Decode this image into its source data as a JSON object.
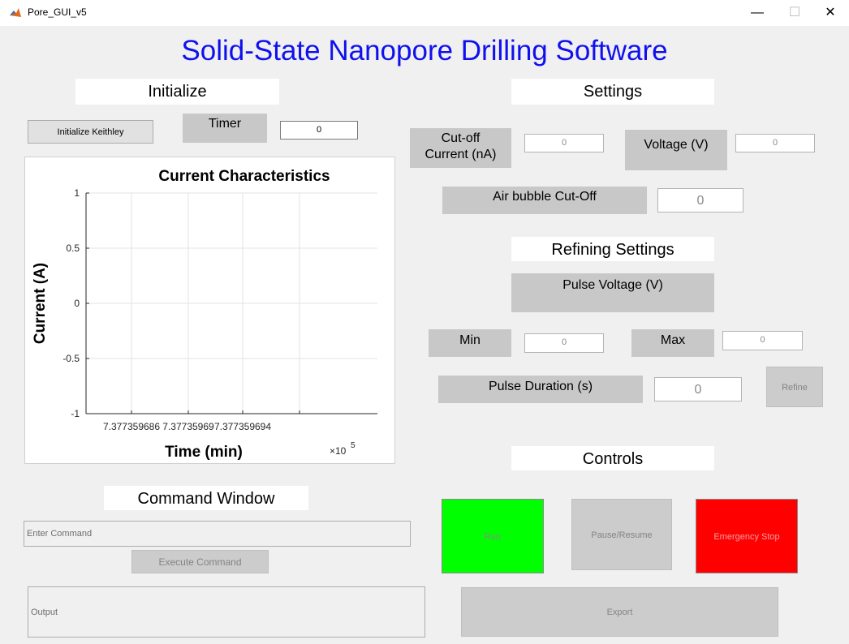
{
  "window": {
    "title": "Pore_GUI_v5",
    "minimize": "—",
    "maximize": "☐",
    "close": "✕"
  },
  "app_title": "Solid-State Nanopore Drilling Software",
  "initialize": {
    "heading": "Initialize",
    "init_button": "Initialize Keithley",
    "timer_label": "Timer",
    "timer_value": "0"
  },
  "settings": {
    "heading": "Settings",
    "cutoff_label_line1": "Cut-off",
    "cutoff_label_line2": "Current (nA)",
    "cutoff_value": "0",
    "voltage_label": "Voltage (V)",
    "voltage_value": "0",
    "airbubble_label": "Air bubble Cut-Off",
    "airbubble_value": "0"
  },
  "refining": {
    "heading": "Refining Settings",
    "pulse_voltage_label": "Pulse Voltage (V)",
    "min_label": "Min",
    "min_value": "0",
    "max_label": "Max",
    "max_value": "0",
    "pulse_duration_label": "Pulse Duration (s)",
    "pulse_duration_value": "0",
    "refine_button": "Refine"
  },
  "controls": {
    "heading": "Controls",
    "run_button": "Run",
    "pause_button": "Pause/Resume",
    "estop_button": "Emergency Stop",
    "export_button": "Export",
    "run_color": "#00ff00",
    "estop_color": "#ff0000"
  },
  "command": {
    "heading": "Command Window",
    "input_value": "Enter Command",
    "execute_button": "Execute Command",
    "output_text": "Output"
  },
  "chart_data": {
    "type": "line",
    "title": "Current Characteristics",
    "xlabel": "Time (min)",
    "ylabel": "Current (A)",
    "x_ticks": [
      "7.377359686",
      "7.37735969",
      "7.377359694"
    ],
    "x_exponent_base": "×10",
    "x_exponent_power": "5",
    "y_ticks": [
      "1",
      "0.5",
      "0",
      "-0.5",
      "-1"
    ],
    "ylim": [
      -1,
      1
    ],
    "grid": true,
    "series": []
  }
}
